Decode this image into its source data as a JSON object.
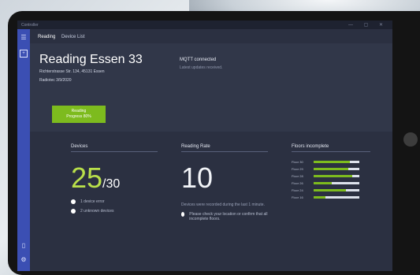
{
  "window": {
    "title": "Controller",
    "controls": "— ▢ ✕"
  },
  "nav": {
    "items": [
      "Reading",
      "Device List"
    ]
  },
  "header": {
    "title": "Reading Essen 33",
    "address": "Richterstrasse Str. 134, 45131 Essen",
    "status": "Radiotec 3/9/2020",
    "button_label": "Reading",
    "button_sub": "Progress 80%"
  },
  "mqtt": {
    "status": "MQTT connected",
    "detail": "Latest updates received."
  },
  "devices": {
    "title": "Devices",
    "count": "25",
    "total": "/30",
    "line1": "1 device error",
    "line2": "2 unknown devices"
  },
  "reading_rate": {
    "title": "Reading Rate",
    "value": "10",
    "note": "Devices were recorded during the last 1 minute.",
    "warning": "Please check your location or confirm that all incomplete floors."
  },
  "floors": {
    "title": "Floors incomplete",
    "items": [
      {
        "label": "Floor 30",
        "progress": 0.8
      },
      {
        "label": "Floor 29",
        "progress": 0.75
      },
      {
        "label": "Floor 28",
        "progress": 0.85
      },
      {
        "label": "Floor 26",
        "progress": 0.4
      },
      {
        "label": "Floor 24",
        "progress": 0.7
      },
      {
        "label": "Floor 16",
        "progress": 0.25
      }
    ]
  },
  "colors": {
    "accent": "#7dbb1e",
    "rail": "#3b4fb3",
    "background": "#2b3041"
  }
}
